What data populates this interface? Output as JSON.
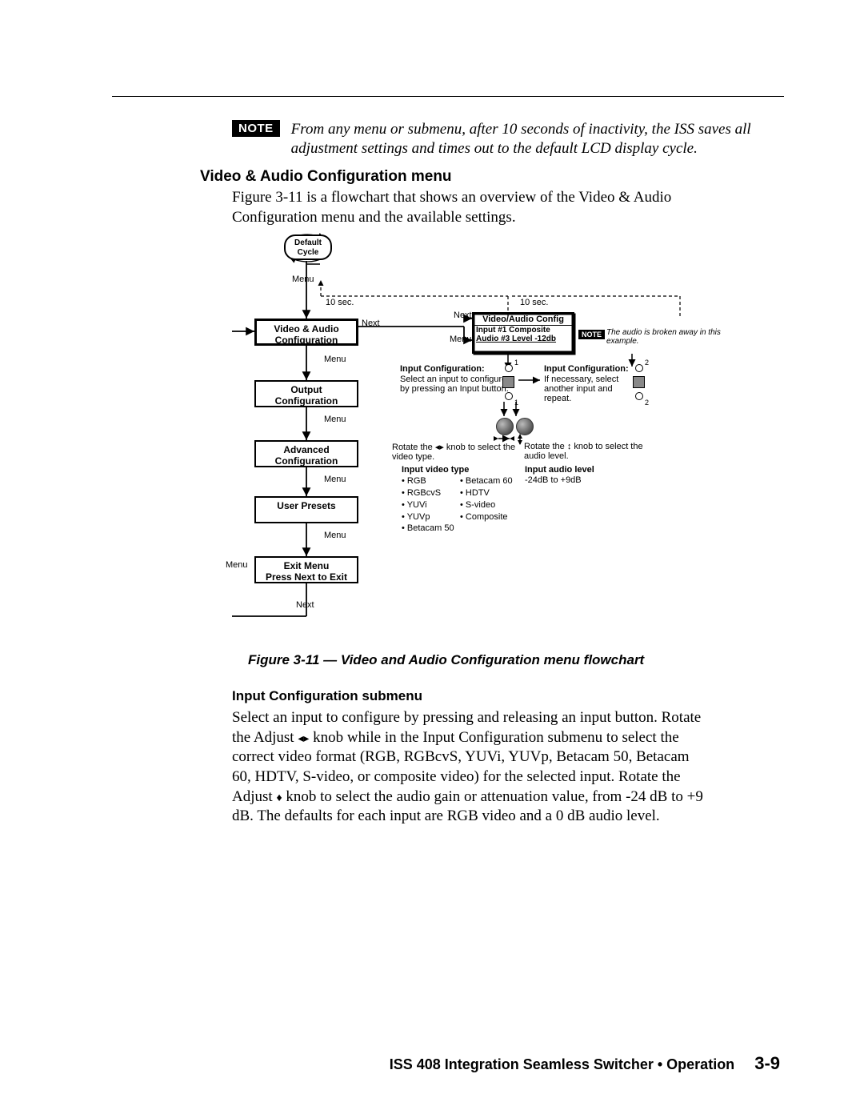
{
  "top_note": {
    "badge": "NOTE",
    "text": "From any menu or submenu, after 10 seconds of inactivity, the ISS saves all adjustment settings and times out to the default LCD display cycle."
  },
  "heading1": "Video & Audio Configuration menu",
  "para1": "Figure 3-11 is a flowchart that shows an overview of the Video & Audio Configuration menu and the available settings.",
  "flow": {
    "default_cycle": "Default Cycle",
    "menu": "Menu",
    "next": "Next",
    "ten_sec": "10 sec.",
    "boxes": {
      "va_config": "Video & Audio\nConfiguration",
      "output_config": "Output\nConfiguration",
      "adv_config": "Advanced\nConfiguration",
      "user_presets": "User Presets",
      "exit_menu": "Exit Menu\nPress Next to Exit",
      "lcd_top": "Video/Audio Config",
      "lcd_line2": "Input #1 Composite",
      "lcd_line3": "Audio #3 Level -12db"
    },
    "mini_note": {
      "badge": "NOTE",
      "text": "The audio is broken away in this example."
    },
    "ic_left": {
      "title": "Input Configuration:",
      "body": "Select an input to configure by pressing an Input button."
    },
    "ic_right": {
      "title": "Input Configuration:",
      "body": "If necessary, select another input and repeat."
    },
    "rotate_left": "Rotate the ◂▸ knob to select the video type.",
    "rotate_right": "Rotate the ↕ knob to select the audio level.",
    "ivt_title": "Input video type",
    "ivt_col1": [
      "RGB",
      "RGBcvS",
      "YUVi",
      "YUVp",
      "Betacam 50"
    ],
    "ivt_col2": [
      "Betacam 60",
      "HDTV",
      "S-video",
      "Composite"
    ],
    "ial_title": "Input audio level",
    "ial_val": "-24dB to +9dB",
    "one": "1",
    "two": "2"
  },
  "fig_caption": "Figure 3-11 — Video and Audio Configuration menu flowchart",
  "heading2": "Input Configuration submenu",
  "para2_a": "Select an input to configure by pressing and releasing an input button.  Rotate the Adjust ",
  "para2_b": " knob while in the Input Configuration submenu to select the correct video format (RGB, RGBcvS, YUVi, YUVp, Betacam 50, Betacam 60, HDTV, S-video, or composite video) for the selected input.  Rotate the Adjust ",
  "para2_c": " knob to select the audio gain or attenuation value, from -24 dB to +9 dB.  The defaults for each input are RGB video and a 0 dB audio level.",
  "footer": {
    "book": "ISS 408 Integration Seamless Switcher • Operation",
    "pagenum": "3-9"
  }
}
